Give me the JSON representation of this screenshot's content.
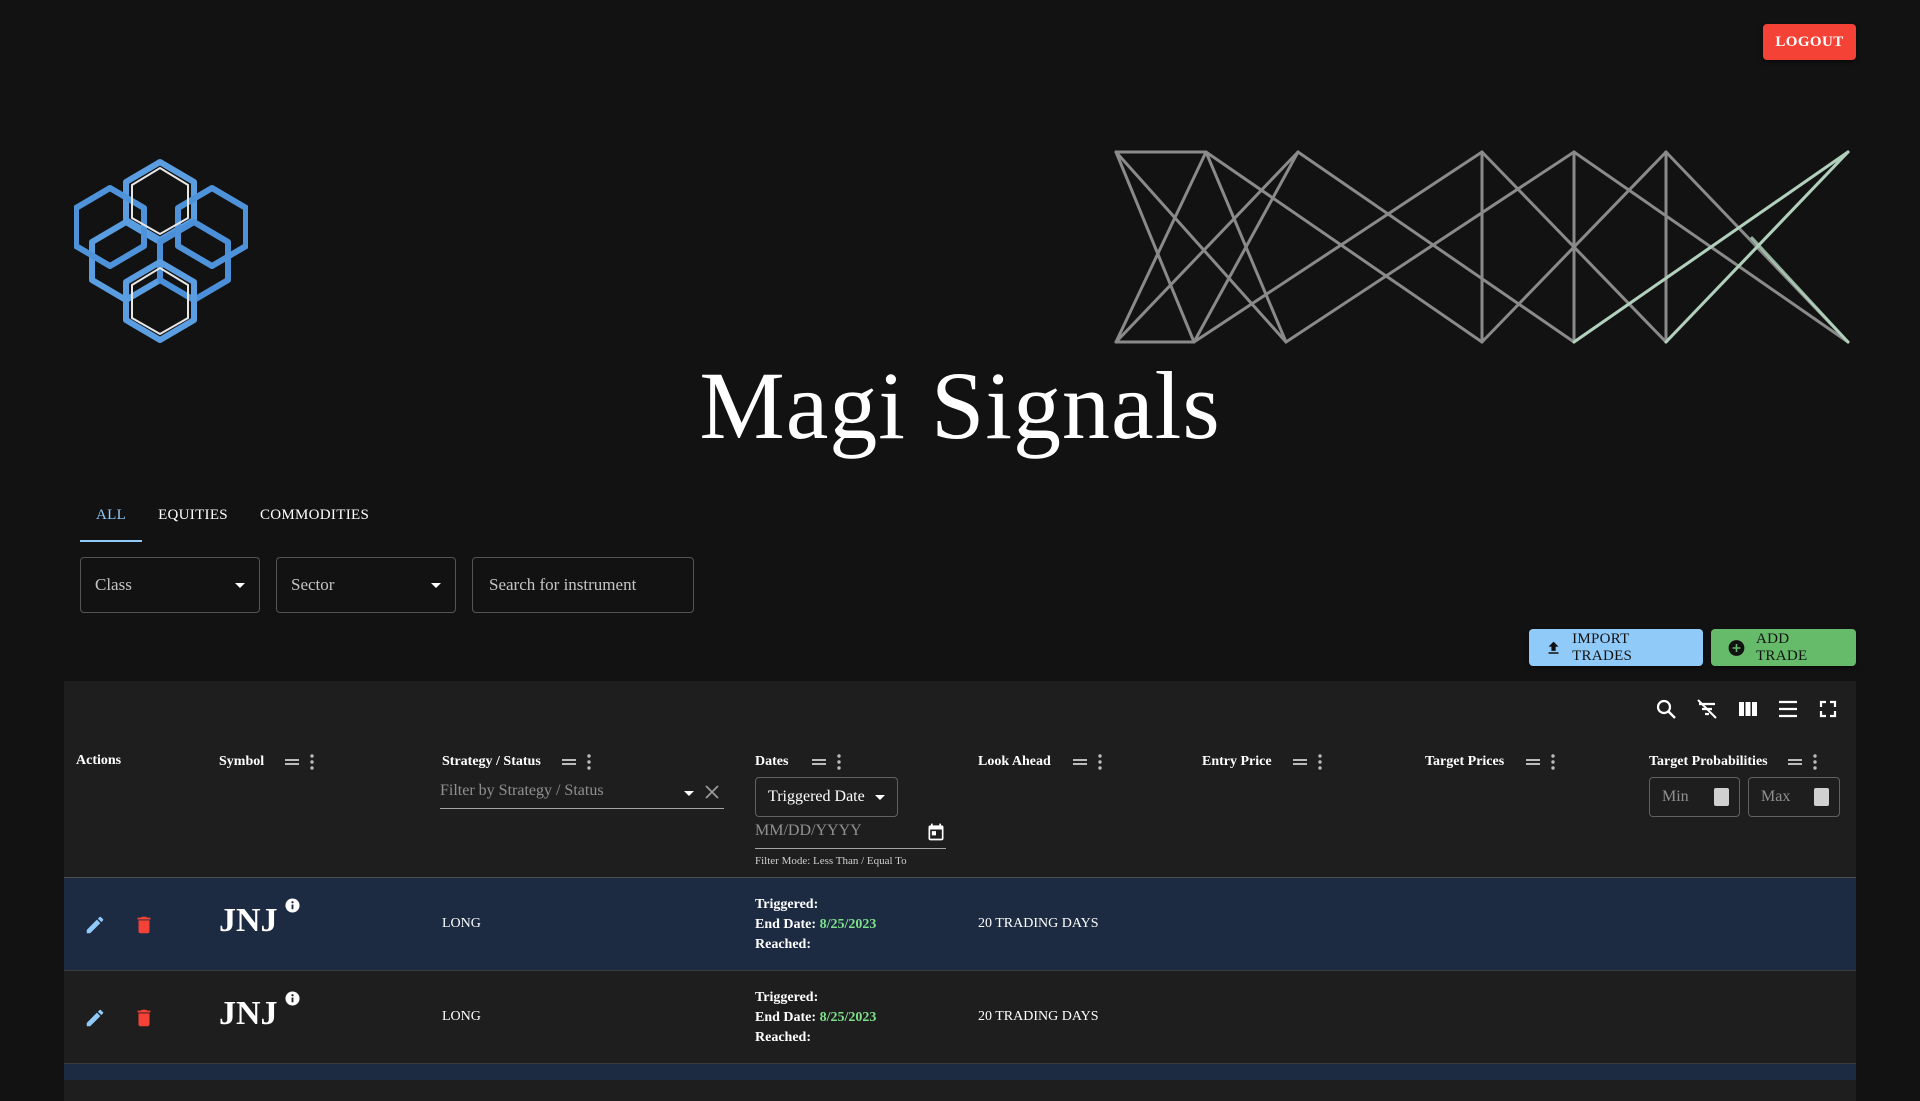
{
  "app": {
    "title": "Magi Signals",
    "logout_label": "LOGOUT"
  },
  "tabs": [
    {
      "label": "ALL",
      "active": true
    },
    {
      "label": "EQUITIES",
      "active": false
    },
    {
      "label": "COMMODITIES",
      "active": false
    }
  ],
  "filters": {
    "class_label": "Class",
    "sector_label": "Sector",
    "search_placeholder": "Search for instrument"
  },
  "actions": {
    "import_label": "IMPORT TRADES",
    "add_label": "ADD TRADE"
  },
  "table": {
    "columns": {
      "actions": "Actions",
      "symbol": "Symbol",
      "strategy": "Strategy / Status",
      "dates": "Dates",
      "look_ahead": "Look Ahead",
      "entry_price": "Entry Price",
      "target_prices": "Target Prices",
      "target_probabilities": "Target Probabilities"
    },
    "strategy_filter_placeholder": "Filter by Strategy / Status",
    "date_mode_value": "Triggered Date",
    "date_placeholder": "MM/DD/YYYY",
    "filter_mode_text": "Filter Mode: Less Than / Equal To",
    "prob_min_placeholder": "Min",
    "prob_max_placeholder": "Max",
    "date_labels": {
      "triggered": "Triggered:",
      "end": "End Date:",
      "reached": "Reached:"
    },
    "rows": [
      {
        "symbol": "JNJ",
        "strategy": "LONG",
        "end_date": "8/25/2023",
        "look_ahead": "20 TRADING DAYS"
      },
      {
        "symbol": "JNJ",
        "strategy": "LONG",
        "end_date": "8/25/2023",
        "look_ahead": "20 TRADING DAYS"
      }
    ]
  },
  "colors": {
    "background": "#121212",
    "panel": "#1e1e1e",
    "accent_blue": "#90caf9",
    "logout_red": "#f44336",
    "add_green": "#66bb6a",
    "date_green": "#7ee08a",
    "selected_row": "#1c2a42"
  }
}
